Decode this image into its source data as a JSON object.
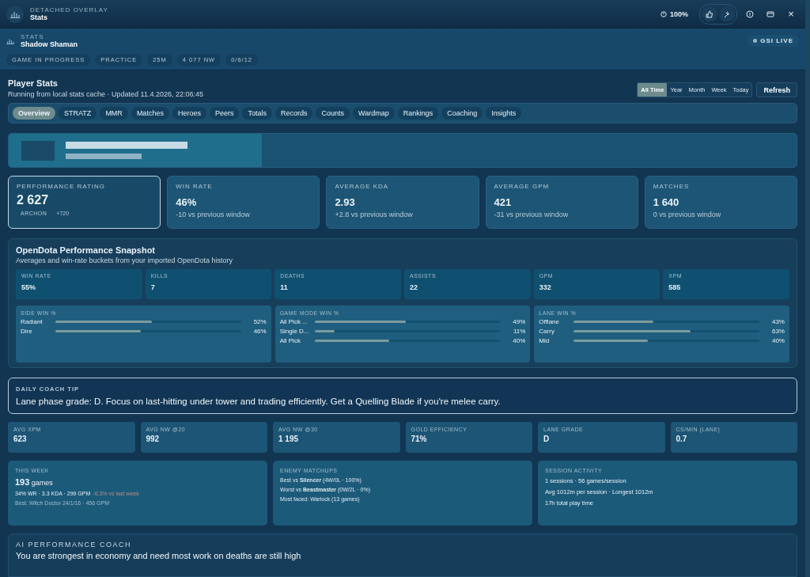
{
  "window": {
    "overline": "DETACHED OVERLAY",
    "title": "Stats",
    "zoom": "100%",
    "close": "×"
  },
  "header": {
    "overline": "STATS",
    "hero": "Shadow Shaman",
    "live": "GSI LIVE",
    "live_on": true,
    "chips": [
      "GAME IN PROGRESS",
      "PRACTICE",
      "25M",
      "4 077 NW",
      "0/6/12"
    ]
  },
  "player_stats": {
    "title": "Player Stats",
    "subtitle": "Running from local stats cache · Updated 11.4.2026, 22:06:45",
    "ranges": [
      {
        "label": "All Time",
        "selected": true
      },
      {
        "label": "Year",
        "selected": false
      },
      {
        "label": "Month",
        "selected": false
      },
      {
        "label": "Week",
        "selected": false
      },
      {
        "label": "Today",
        "selected": false
      }
    ],
    "refresh": "Refresh"
  },
  "tabs": [
    {
      "label": "Overview",
      "selected": true
    },
    {
      "label": "STRATZ",
      "selected": false
    },
    {
      "label": "MMR",
      "selected": false
    },
    {
      "label": "Matches",
      "selected": false
    },
    {
      "label": "Heroes",
      "selected": false
    },
    {
      "label": "Peers",
      "selected": false
    },
    {
      "label": "Totals",
      "selected": false
    },
    {
      "label": "Records",
      "selected": false
    },
    {
      "label": "Counts",
      "selected": false
    },
    {
      "label": "Wardmap",
      "selected": false
    },
    {
      "label": "Rankings",
      "selected": false
    },
    {
      "label": "Coaching",
      "selected": false
    },
    {
      "label": "Insights",
      "selected": false
    }
  ],
  "metrics": [
    {
      "label": "PERFORMANCE RATING",
      "value": "2 627",
      "selected": true,
      "kind": "rating",
      "rank": "ARCHON",
      "extra": "+720"
    },
    {
      "label": "WIN RATE",
      "value": "46%",
      "selected": false,
      "kind": "delta",
      "note": "-10 vs previous window"
    },
    {
      "label": "AVERAGE KDA",
      "value": "2.93",
      "selected": false,
      "kind": "delta",
      "note": "+2.8 vs previous window"
    },
    {
      "label": "AVERAGE GPM",
      "value": "421",
      "selected": false,
      "kind": "delta",
      "note": "-31 vs previous window"
    },
    {
      "label": "MATCHES",
      "value": "1 640",
      "selected": false,
      "kind": "delta",
      "note": "0 vs previous window"
    }
  ],
  "snapshot": {
    "title": "OpenDota Performance Snapshot",
    "subtitle": "Averages and win-rate buckets from your imported OpenDota history",
    "stats": [
      {
        "label": "WIN RATE",
        "value": "55%"
      },
      {
        "label": "KILLS",
        "value": "7"
      },
      {
        "label": "DEATHS",
        "value": "11"
      },
      {
        "label": "ASSISTS",
        "value": "22"
      },
      {
        "label": "GPM",
        "value": "332"
      },
      {
        "label": "XPM",
        "value": "585"
      }
    ],
    "buckets": [
      {
        "title": "SIDE WIN %",
        "rows": [
          {
            "name": "Radiant",
            "level": 0.52,
            "reading": "52%"
          },
          {
            "name": "Dire",
            "level": 0.46,
            "reading": "46%"
          }
        ]
      },
      {
        "title": "GAME MODE WIN %",
        "rows": [
          {
            "name": "All Pick ...",
            "level": 0.49,
            "reading": "49%"
          },
          {
            "name": "Single D...",
            "level": 0.11,
            "reading": "11%"
          },
          {
            "name": "All Pick",
            "level": 0.4,
            "reading": "40%"
          }
        ]
      },
      {
        "title": "LANE WIN %",
        "rows": [
          {
            "name": "Offlane",
            "level": 0.43,
            "reading": "43%"
          },
          {
            "name": "Carry",
            "level": 0.63,
            "reading": "63%"
          },
          {
            "name": "Mid",
            "level": 0.4,
            "reading": "40%"
          }
        ]
      }
    ]
  },
  "coach_tip": {
    "label": "DAILY COACH TIP",
    "text": "Lane phase grade: D. Focus on last-hitting under tower and trading efficiently. Get a Quelling Blade if you're melee carry."
  },
  "small_metrics": [
    {
      "label": "AVG XPM",
      "value": "623"
    },
    {
      "label": "AVG NW @20",
      "value": "992"
    },
    {
      "label": "AVG NW @30",
      "value": "1 195"
    },
    {
      "label": "GOLD EFFICIENCY",
      "value": "71%"
    },
    {
      "label": "LANE GRADE",
      "value": "D"
    },
    {
      "label": "CS/MIN (LANE)",
      "value": "0.7"
    }
  ],
  "this_week": {
    "label": "THIS WEEK",
    "count": "**193** games",
    "line": "34% WR · 3.3 KDA · 299 GPM",
    "change": "-6.3% vs last week",
    "best": "Best: Witch Doctor 24/1/16 · 456 GPM"
  },
  "enemy_matchups": {
    "label": "ENEMY MATCHUPS",
    "lines": [
      {
        "text": "Best vs **Silencer** (4W/0L · 100%)"
      },
      {
        "text": "Worst vs **Beastmaster** (0W/2L · 0%)"
      },
      {
        "text": "Most faced: Warlock (13 games)"
      }
    ]
  },
  "session_activity": {
    "label": "SESSION ACTIVITY",
    "lines": [
      "1 sessions · 56 games/session",
      "Avg 1012m per session · Longest 1012m",
      "17h total play time"
    ]
  },
  "ai_coach": {
    "label": "AI PERFORMANCE COACH",
    "text": "You are strongest in economy and need most work on deaths are still high"
  }
}
